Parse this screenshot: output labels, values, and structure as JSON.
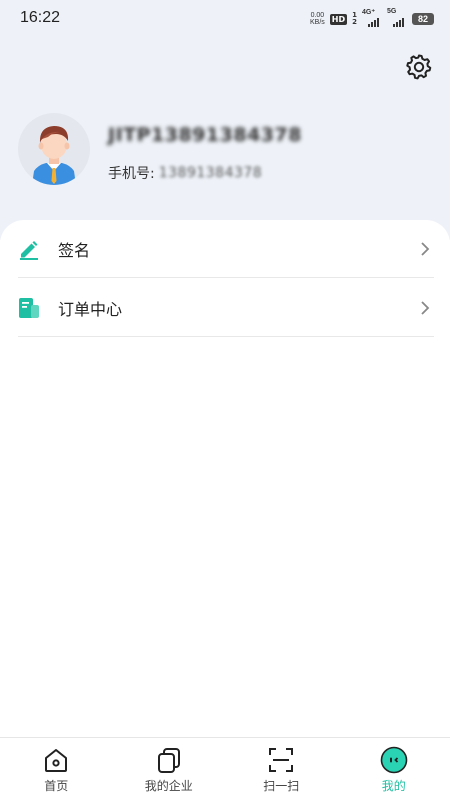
{
  "status_bar": {
    "time": "16:22",
    "net_speed_value": "0.00",
    "net_speed_unit": "KB/s",
    "hd_label": "HD",
    "sim_slot_1": "1",
    "sim_slot_2": "2",
    "network_1": "4G⁺",
    "network_2": "5G",
    "battery": "82"
  },
  "profile": {
    "name": "JITP13891384378",
    "phone_label": "手机号:",
    "phone_value": "13891384378"
  },
  "menu": {
    "items": [
      {
        "label": "签名",
        "icon": "edit-pen-icon"
      },
      {
        "label": "订单中心",
        "icon": "order-document-icon"
      }
    ]
  },
  "tabbar": {
    "items": [
      {
        "label": "首页",
        "icon": "home-icon",
        "active": false
      },
      {
        "label": "我的企业",
        "icon": "enterprise-icon",
        "active": false
      },
      {
        "label": "扫一扫",
        "icon": "scan-icon",
        "active": false
      },
      {
        "label": "我的",
        "icon": "profile-face-icon",
        "active": true
      }
    ]
  },
  "colors": {
    "accent": "#1fbfa3",
    "header_bg": "#eef2f8",
    "avatar_shirt": "#3b8fe0",
    "avatar_tie": "#f2b133"
  }
}
